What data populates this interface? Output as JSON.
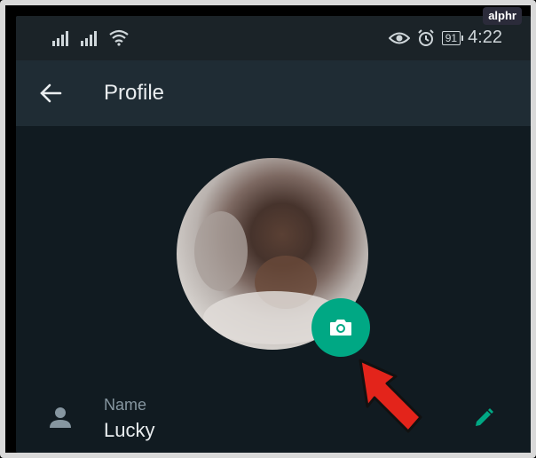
{
  "watermark": "alphr",
  "status_bar": {
    "battery": "91",
    "time": "4:22"
  },
  "app_bar": {
    "title": "Profile"
  },
  "profile": {
    "name_label": "Name",
    "name_value": "Lucky"
  },
  "colors": {
    "accent": "#00a884",
    "background": "#111b21",
    "app_bar": "#1f2c34",
    "arrow": "#e3241b"
  },
  "icons": [
    "signal-icon",
    "wifi-icon",
    "eye-icon",
    "alarm-icon",
    "battery-icon",
    "back-arrow-icon",
    "camera-icon",
    "person-icon",
    "pencil-icon",
    "red-arrow-icon"
  ]
}
